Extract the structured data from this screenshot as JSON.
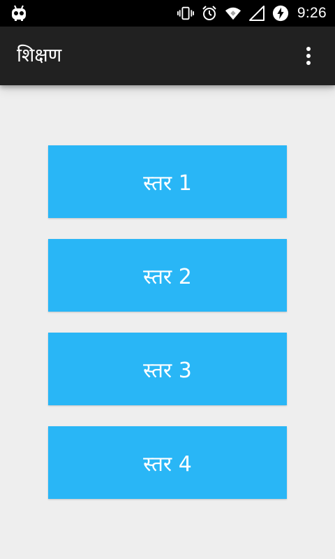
{
  "status_bar": {
    "time": "9:26",
    "icons": [
      "robot-notification-icon",
      "vibrate-icon",
      "alarm-icon",
      "wifi-icon",
      "signal-icon",
      "battery-charging-icon"
    ]
  },
  "app_bar": {
    "title": "शिक्षण",
    "overflow_icon": "more-vert-icon"
  },
  "levels": [
    {
      "label": "स्तर 1"
    },
    {
      "label": "स्तर 2"
    },
    {
      "label": "स्तर 3"
    },
    {
      "label": "स्तर 4"
    }
  ],
  "colors": {
    "status_bar": "#000000",
    "app_bar": "#212121",
    "background": "#eeeeee",
    "button": "#29b6f6",
    "button_text": "#ffffff"
  }
}
